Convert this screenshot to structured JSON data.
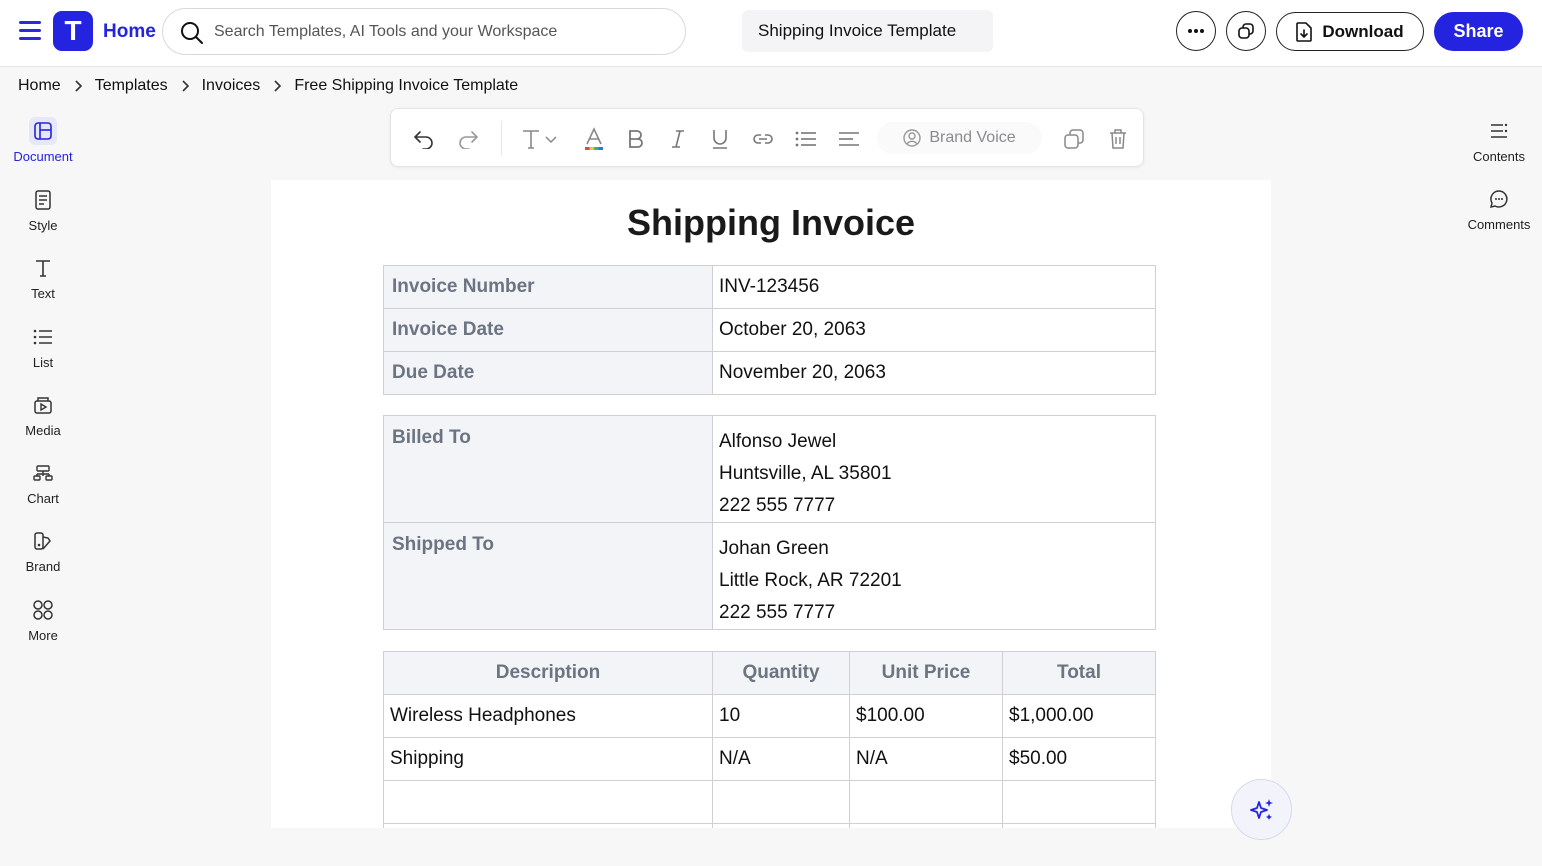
{
  "topbar": {
    "home_label": "Home",
    "logo_letter": "T",
    "search_placeholder": "Search Templates, AI Tools and your Workspace",
    "doc_title": "Shipping Invoice Template",
    "download_label": "Download",
    "share_label": "Share",
    "accent_color": "#2323e0"
  },
  "breadcrumb": [
    "Home",
    "Templates",
    "Invoices",
    "Free Shipping Invoice Template"
  ],
  "left_sidebar": [
    {
      "label": "Document",
      "icon": "layout-icon",
      "active": true
    },
    {
      "label": "Style",
      "icon": "style-icon"
    },
    {
      "label": "Text",
      "icon": "text-icon"
    },
    {
      "label": "List",
      "icon": "list-icon"
    },
    {
      "label": "Media",
      "icon": "media-icon"
    },
    {
      "label": "Chart",
      "icon": "chart-icon"
    },
    {
      "label": "Brand",
      "icon": "brand-icon"
    },
    {
      "label": "More",
      "icon": "grid-icon"
    }
  ],
  "right_sidebar": [
    {
      "label": "Contents",
      "icon": "contents-icon"
    },
    {
      "label": "Comments",
      "icon": "comment-icon"
    }
  ],
  "toolbar": {
    "brand_voice_label": "Brand Voice"
  },
  "invoice": {
    "title": "Shipping Invoice",
    "info": [
      {
        "label": "Invoice Number",
        "value": "INV-123456"
      },
      {
        "label": "Invoice Date",
        "value": "October 20, 2063"
      },
      {
        "label": "Due Date",
        "value": "November 20, 2063"
      }
    ],
    "billed_to": {
      "label": "Billed To",
      "lines": [
        "Alfonso Jewel",
        "Huntsville, AL 35801",
        "222 555 7777"
      ]
    },
    "shipped_to": {
      "label": "Shipped To",
      "lines": [
        "Johan Green",
        "Little Rock, AR 72201",
        "222 555 7777"
      ]
    },
    "items_header": [
      "Description",
      "Quantity",
      "Unit Price",
      "Total"
    ],
    "items": [
      [
        "Wireless Headphones",
        "10",
        "$100.00",
        "$1,000.00"
      ],
      [
        "Shipping",
        "N/A",
        "N/A",
        "$50.00"
      ],
      [
        "",
        "",
        "",
        ""
      ]
    ]
  }
}
